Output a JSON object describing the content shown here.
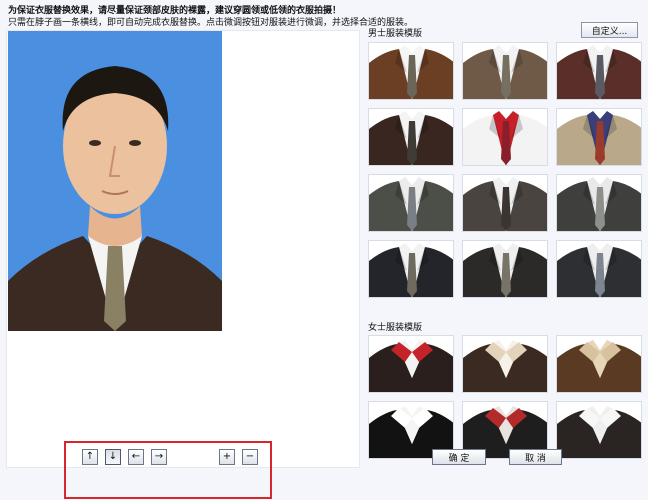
{
  "notice": "为保证衣服替换效果，请尽量保证颈部皮肤的裸露，建议穿圆领或低领的衣服拍摄！",
  "hint": "只需在脖子画一条横线，即可自动完成衣服替换。点击微调按钮对服装进行微调，并选择合适的服装。",
  "custom_button": "自定义...",
  "male_section": {
    "label": "男士服装模版",
    "suits": [
      {
        "jacket": "#6b3f24",
        "shirt": "#f5f5f5",
        "tie": "#6b6658"
      },
      {
        "jacket": "#6f5a48",
        "shirt": "#f2f2f2",
        "tie": "#75705f"
      },
      {
        "jacket": "#5a2f2a",
        "shirt": "#f2f2f2",
        "tie": "#5b5a63"
      },
      {
        "jacket": "#3a2620",
        "shirt": "#f4f4f4",
        "tie": "#3f3b37"
      },
      {
        "jacket": "#f3f3f3",
        "shirt": "#c8202a",
        "tie": "#8a1f2b"
      },
      {
        "jacket": "#b9a98a",
        "shirt": "#3a3f7a",
        "tie": "#9a3a2b"
      },
      {
        "jacket": "#4b4f47",
        "shirt": "#ececec",
        "tie": "#7a7f86"
      },
      {
        "jacket": "#4a4440",
        "shirt": "#f0f0f0",
        "tie": "#3b3430"
      },
      {
        "jacket": "#3f3f3d",
        "shirt": "#e9e9e9",
        "tie": "#8c8f8a"
      },
      {
        "jacket": "#23252a",
        "shirt": "#f2f2f2",
        "tie": "#6e6a5e"
      },
      {
        "jacket": "#2b2a29",
        "shirt": "#efefef",
        "tie": "#777366"
      },
      {
        "jacket": "#2d2f33",
        "shirt": "#eeeeee",
        "tie": "#7d8590"
      }
    ]
  },
  "female_section": {
    "label": "女士服装模版",
    "outfits": [
      {
        "jacket": "#2a1f1c",
        "blouse": "#f3f3f3",
        "collar": "#c32329"
      },
      {
        "jacket": "#3a2a21",
        "blouse": "#f6f1ea",
        "collar": "#e3d3b9"
      },
      {
        "jacket": "#5a3a22",
        "blouse": "#e7d6b8",
        "collar": "#d8c29e"
      },
      {
        "jacket": "#121212",
        "blouse": "#f5f5f5",
        "collar": "#ffffff"
      },
      {
        "jacket": "#1e1e1e",
        "blouse": "#e9e3df",
        "collar": "#b32a2a"
      },
      {
        "jacket": "#2a2523",
        "blouse": "#efefef",
        "collar": "#f7f7f7"
      }
    ]
  },
  "controls": [
    {
      "name": "move-up-button",
      "glyph": "↑",
      "pressed": false
    },
    {
      "name": "move-down-button",
      "glyph": "↓",
      "pressed": true
    },
    {
      "name": "move-left-button",
      "glyph": "←",
      "pressed": false
    },
    {
      "name": "move-right-button",
      "glyph": "→",
      "pressed": false
    },
    {
      "name": "zoom-in-button",
      "glyph": "+",
      "pressed": false
    },
    {
      "name": "zoom-out-button",
      "glyph": "−",
      "pressed": false
    }
  ],
  "ok_button": "确 定",
  "cancel_button": "取 消",
  "colors": {
    "photo_background": "#4a8fe0",
    "highlight_frame": "#d8262e"
  }
}
